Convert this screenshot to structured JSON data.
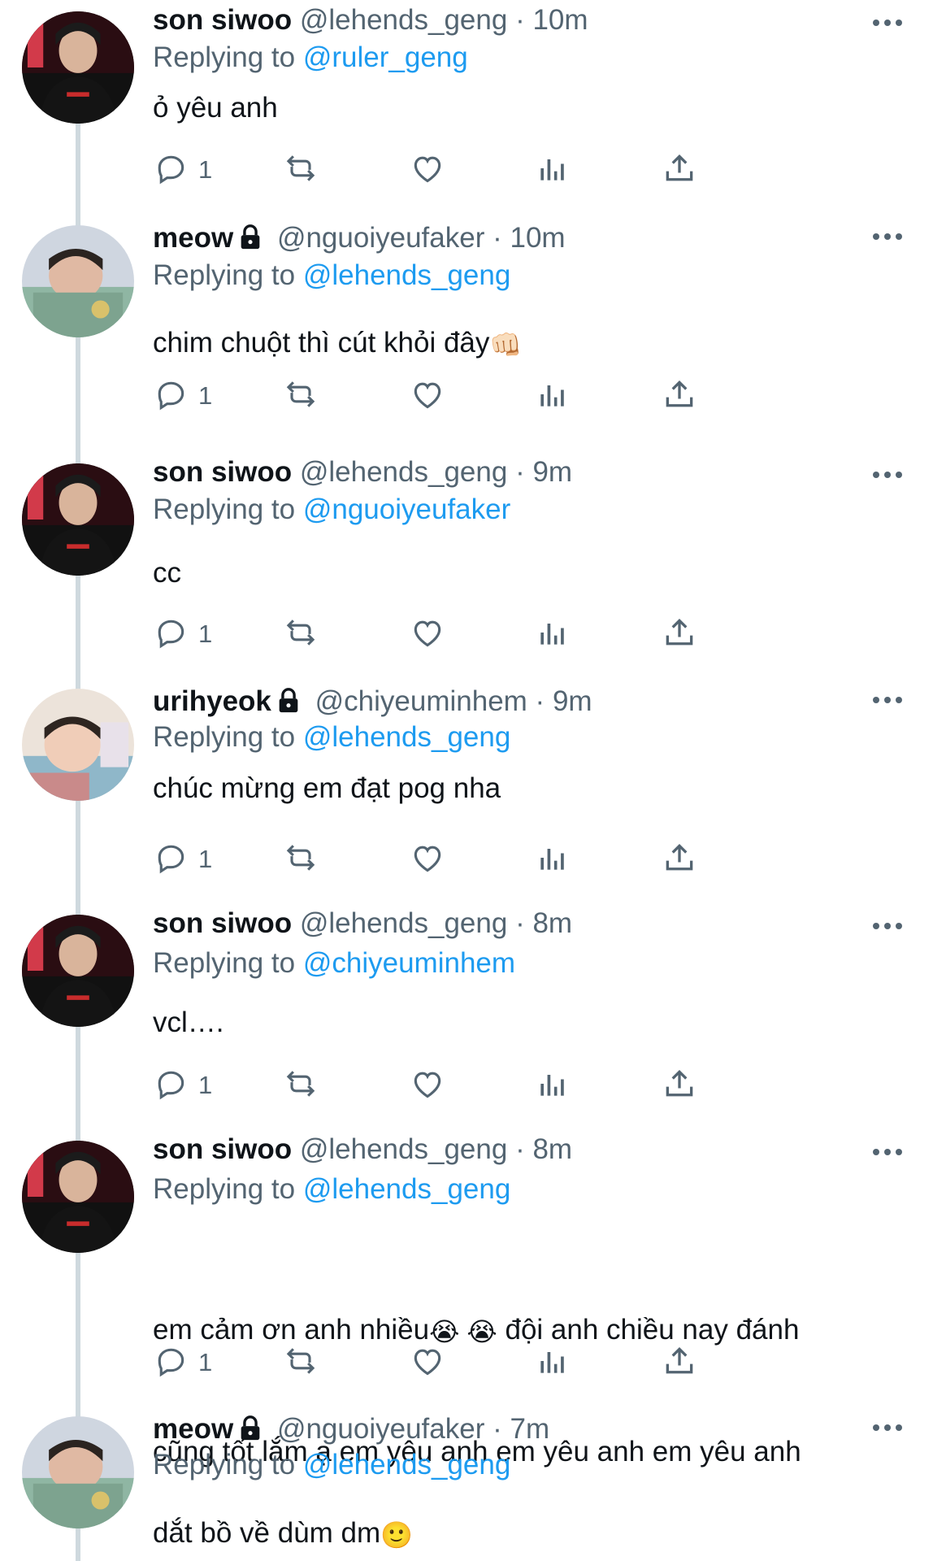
{
  "tweets": [
    {
      "name": "son siwoo",
      "locked": false,
      "handle": "@lehends_geng",
      "time": "10m",
      "replying_label": "Replying to",
      "replying_to": "@ruler_geng",
      "text": "ỏ yêu anh",
      "emojis": "",
      "reply_count": "1"
    },
    {
      "name": "meow",
      "locked": true,
      "handle": "@nguoiyeufaker",
      "time": "10m",
      "replying_label": "Replying to",
      "replying_to": "@lehends_geng",
      "text": "chim chuột thì cút khỏi đây",
      "emojis": "👊🏻",
      "reply_count": "1"
    },
    {
      "name": "son siwoo",
      "locked": false,
      "handle": "@lehends_geng",
      "time": "9m",
      "replying_label": "Replying to",
      "replying_to": "@nguoiyeufaker",
      "text": "cc",
      "emojis": "",
      "reply_count": "1"
    },
    {
      "name": "urihyeok",
      "locked": true,
      "handle": "@chiyeuminhem",
      "time": "9m",
      "replying_label": "Replying to",
      "replying_to": "@lehends_geng",
      "text": "chúc mừng em đạt pog nha",
      "emojis": "",
      "reply_count": "1"
    },
    {
      "name": "son siwoo",
      "locked": false,
      "handle": "@lehends_geng",
      "time": "8m",
      "replying_label": "Replying to",
      "replying_to": "@chiyeuminhem",
      "text": "vcl….",
      "emojis": "",
      "reply_count": "1"
    },
    {
      "name": "son siwoo",
      "locked": false,
      "handle": "@lehends_geng",
      "time": "8m",
      "replying_label": "Replying to",
      "replying_to": "@lehends_geng",
      "text_line1": "em cảm ơn anh nhiều",
      "emojis_line1": "😭 😭",
      "text_line1b": " đội anh chiều nay đánh",
      "text_line2": "cũng tốt lắm ạ em yêu anh em yêu anh em yêu anh",
      "reply_count": "1"
    },
    {
      "name": "meow",
      "locked": true,
      "handle": "@nguoiyeufaker",
      "time": "7m",
      "replying_label": "Replying to",
      "replying_to": "@lehends_geng",
      "text": "dắt bồ về dùm dm",
      "emojis": "🙂"
    }
  ],
  "icons": {
    "reply": "reply-icon",
    "retweet": "retweet-icon",
    "like": "heart-icon",
    "views": "views-icon",
    "share": "share-icon",
    "more": "more-icon",
    "lock": "lock-icon"
  },
  "colors": {
    "link": "#1d9bf0",
    "muted": "#536471",
    "text": "#0f1419",
    "thread": "#cfd9de"
  }
}
